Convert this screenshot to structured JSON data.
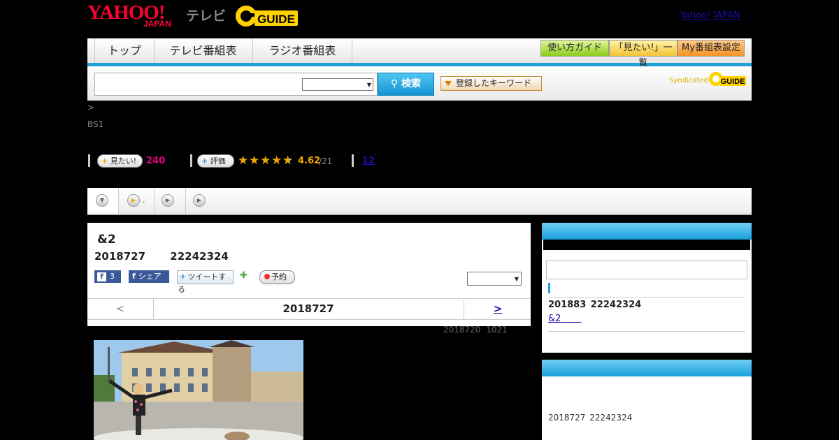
{
  "header": {
    "logo_yahoo": "YAHOO!",
    "logo_japan": "JAPAN",
    "logo_tv": "テレビ",
    "logo_gguide": "G-GUIDE",
    "top_link": "Yahoo! JAPAN",
    "top_dot": ".",
    "mid_dot": "."
  },
  "nav": {
    "tabs": [
      "トップ",
      "テレビ番組表",
      "ラジオ番組表"
    ],
    "guides": [
      "使い方ガイド",
      "「見たい!」一覧",
      "My番組表設定"
    ]
  },
  "search": {
    "input_value": "",
    "button_label": "検索",
    "keyword_button": "登録したキーワード",
    "syndicated": "Syndicated"
  },
  "breadcrumb": {
    "separator": ">",
    "channel": "BS1"
  },
  "stats": {
    "want_label": "見たい!",
    "want_count": "240",
    "eval_label": "評価",
    "rating": "4.62",
    "rating_count": "/21",
    "review_count": "12",
    "stars": 4.62
  },
  "tabs_strip": {
    "tab2_label": "."
  },
  "program": {
    "title": "&2",
    "date_time": "2018727 22242324",
    "fb_like_count": "3",
    "fb_share": "シェア",
    "tweet": "ツイートする",
    "reserve": "予約",
    "pager_prev": "<",
    "pager_current": "2018727",
    "pager_next": ">",
    "updated": "2018720 1021"
  },
  "sidebar": {
    "next_date": "201883 22242324",
    "next_link": "&2",
    "prev_date": "2018727 22242324"
  },
  "colors": {
    "accent_blue": "#1ea0d8",
    "yahoo_red": "#ff0033",
    "want_pink": "#e4007f",
    "star_gold": "#f0a800"
  }
}
